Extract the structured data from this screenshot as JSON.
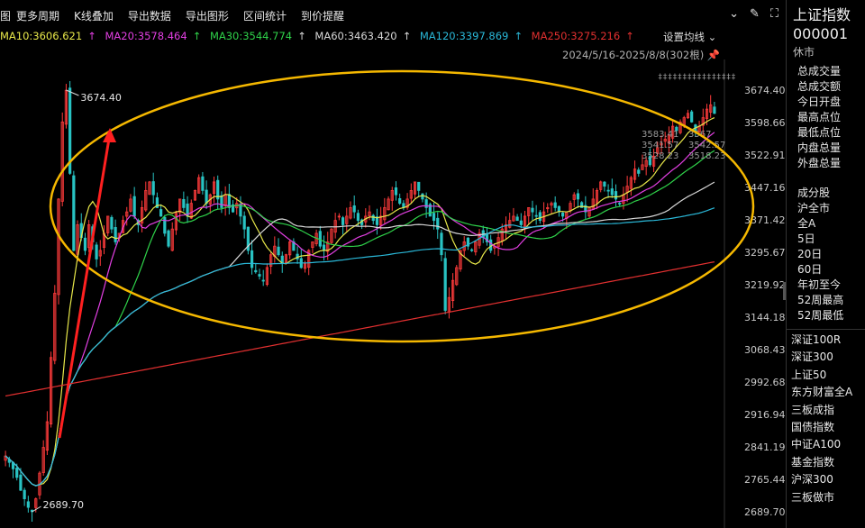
{
  "toolbar": {
    "items": [
      "图",
      "更多周期",
      "K线叠加",
      "导出数据",
      "导出图形",
      "区间统计",
      "到价提醒"
    ]
  },
  "ma": [
    {
      "label": "MA10:3606.621",
      "color": "#e8e84a"
    },
    {
      "label": "MA20:3578.464",
      "color": "#e23fe2"
    },
    {
      "label": "MA30:3544.774",
      "color": "#2fd34a"
    },
    {
      "label": "MA60:3463.420",
      "color": "#d8d8d8"
    },
    {
      "label": "MA120:3397.869",
      "color": "#2ab8d8"
    },
    {
      "label": "MA250:3275.216",
      "color": "#e23030"
    }
  ],
  "settings_label": "设置均线",
  "date_range": "2024/5/16-2025/8/8(302根)",
  "chart_data": {
    "type": "candlestick",
    "y_ticks": [
      "3674.40",
      "3598.66",
      "3522.91",
      "3447.16",
      "3371.42",
      "3295.67",
      "3219.92",
      "3144.18",
      "3068.43",
      "2992.68",
      "2916.94",
      "2841.19",
      "2765.44",
      "2689.70"
    ],
    "annotations": {
      "high": "3674.40",
      "low": "2689.70"
    },
    "ylim": [
      2689.7,
      3674.4
    ],
    "mini_labels": [
      "3583.41",
      "3567",
      "3541.57",
      "3542.57",
      "3528.23",
      "3518.23"
    ],
    "closes": [
      2820,
      2805,
      2790,
      2770,
      2740,
      2720,
      2700,
      2690,
      2720,
      2780,
      2840,
      2900,
      3050,
      3200,
      3420,
      3600,
      3674,
      3480,
      3300,
      3360,
      3330,
      3300,
      3360,
      3320,
      3280,
      3300,
      3340,
      3380,
      3350,
      3320,
      3340,
      3370,
      3390,
      3420,
      3380,
      3360,
      3400,
      3440,
      3460,
      3430,
      3400,
      3380,
      3340,
      3310,
      3350,
      3390,
      3420,
      3400,
      3380,
      3410,
      3440,
      3470,
      3440,
      3410,
      3430,
      3460,
      3420,
      3400,
      3430,
      3400,
      3390,
      3410,
      3380,
      3350,
      3300,
      3260,
      3250,
      3240,
      3230,
      3260,
      3290,
      3310,
      3290,
      3270,
      3290,
      3320,
      3300,
      3280,
      3260,
      3270,
      3300,
      3320,
      3340,
      3310,
      3300,
      3320,
      3350,
      3370,
      3380,
      3360,
      3380,
      3400,
      3390,
      3370,
      3360,
      3380,
      3390,
      3370,
      3360,
      3380,
      3400,
      3420,
      3440,
      3430,
      3410,
      3400,
      3420,
      3440,
      3460,
      3440,
      3420,
      3400,
      3380,
      3370,
      3350,
      3290,
      3160,
      3190,
      3230,
      3260,
      3300,
      3320,
      3310,
      3300,
      3320,
      3340,
      3330,
      3320,
      3300,
      3310,
      3330,
      3350,
      3360,
      3370,
      3380,
      3370,
      3360,
      3380,
      3400,
      3390,
      3380,
      3370,
      3390,
      3400,
      3410,
      3400,
      3390,
      3380,
      3390,
      3410,
      3430,
      3420,
      3400,
      3390,
      3400,
      3420,
      3440,
      3460,
      3450,
      3440,
      3430,
      3420,
      3410,
      3430,
      3450,
      3470,
      3490,
      3480,
      3500,
      3510,
      3500,
      3520,
      3540,
      3550,
      3560,
      3570,
      3590,
      3580,
      3600,
      3610,
      3620,
      3600,
      3580,
      3590,
      3610,
      3630,
      3640,
      3620
    ]
  },
  "right_panel": {
    "title": "上证指数",
    "code": "000001",
    "status": "休市",
    "stats": [
      "总成交量",
      "总成交额",
      "今日开盘",
      "最高点位",
      "最低点位",
      "内盘总量",
      "外盘总量"
    ],
    "periods": [
      "成分股",
      "沪全市",
      "全A",
      "5日",
      "20日",
      "60日",
      "年初至今",
      "52周最高",
      "52周最低"
    ],
    "indices": [
      "深证100R",
      "深证300",
      "上证50",
      "东方财富全A",
      "三板成指",
      "国债指数",
      "中证A100",
      "基金指数",
      "沪深300",
      "三板做市"
    ]
  },
  "colors": {
    "up": "#ff3b3b",
    "down": "#29c3c3",
    "ellipse": "#f5b800",
    "arrow": "#ff2020"
  }
}
